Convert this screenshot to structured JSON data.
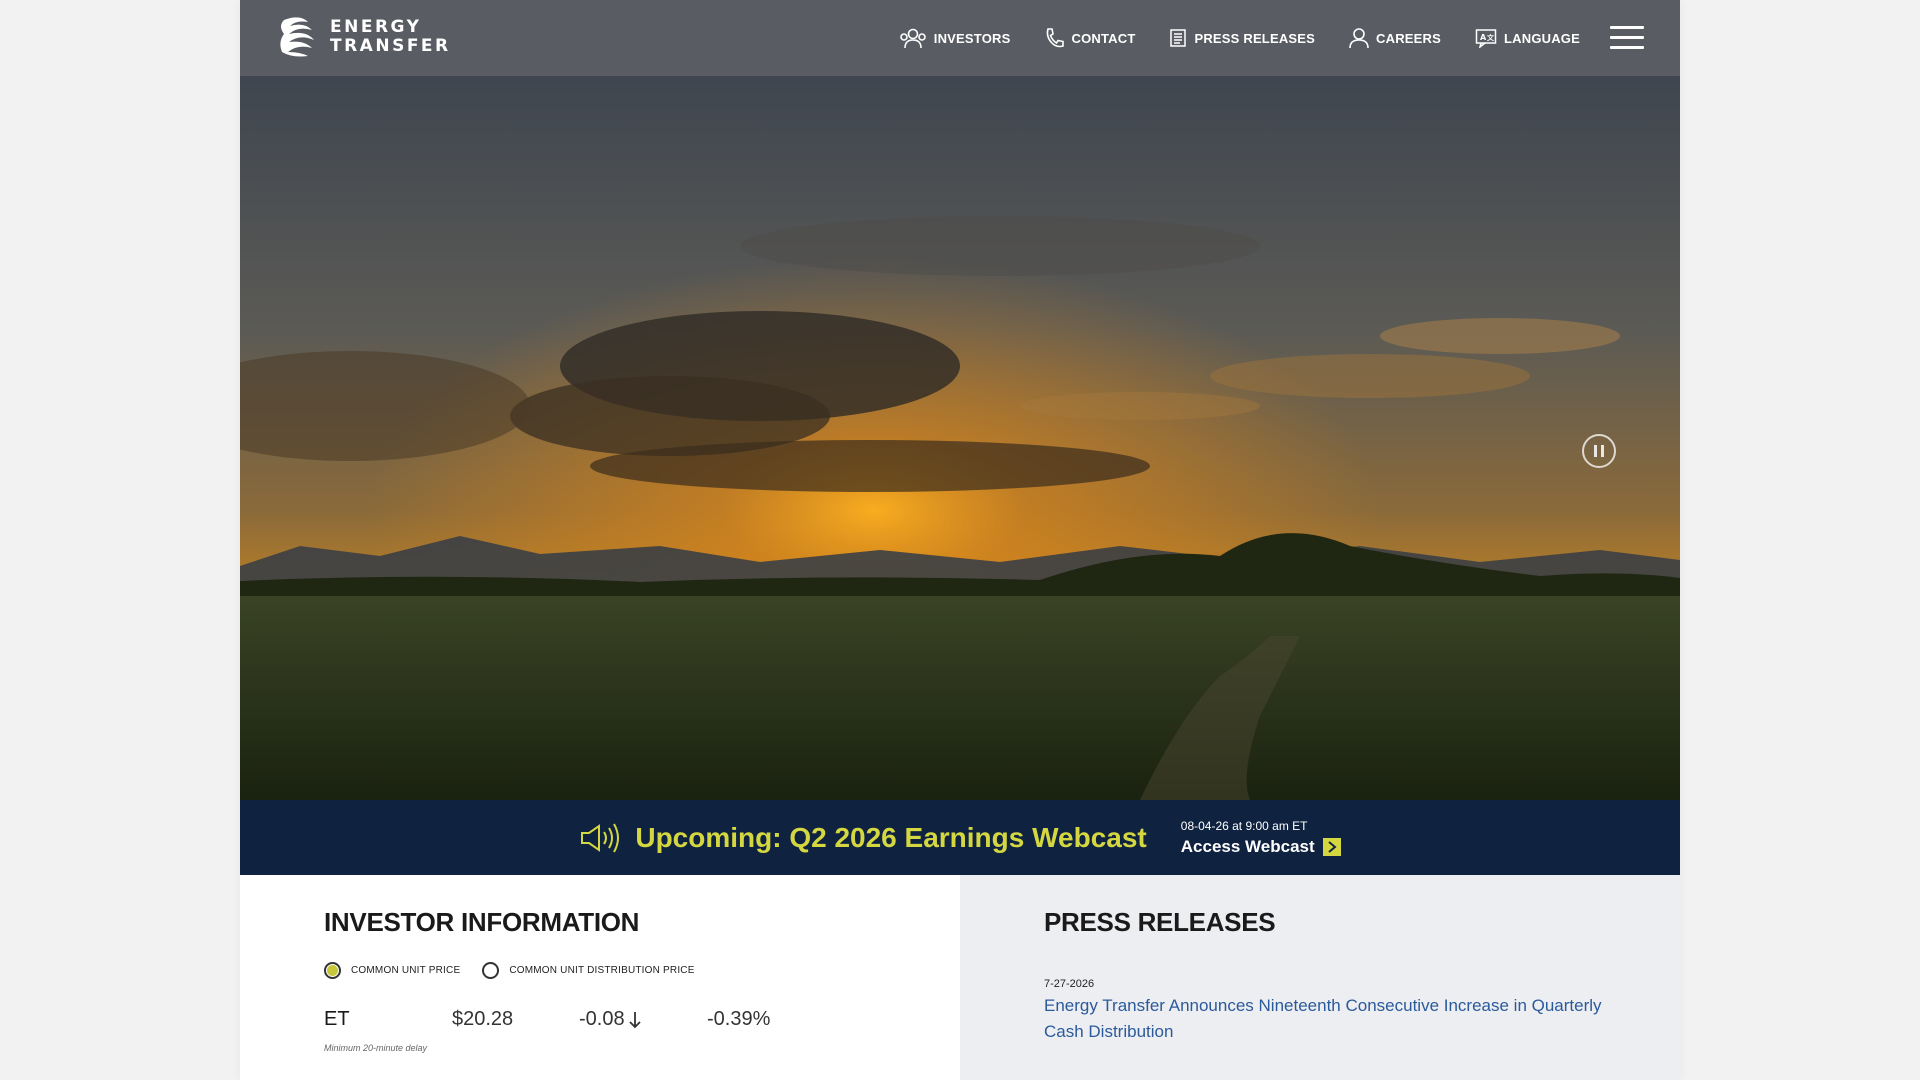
{
  "logo": {
    "line1": "ENERGY",
    "line2": "TRANSFER"
  },
  "nav": {
    "items": [
      {
        "label": "INVESTORS",
        "icon": "investors-icon"
      },
      {
        "label": "CONTACT",
        "icon": "phone-icon"
      },
      {
        "label": "PRESS RELEASES",
        "icon": "document-icon"
      },
      {
        "label": "CAREERS",
        "icon": "person-icon"
      },
      {
        "label": "LANGUAGE",
        "icon": "language-icon"
      }
    ],
    "menu_icon": "hamburger-menu-icon"
  },
  "hero": {
    "pause_icon": "pause-icon"
  },
  "banner": {
    "title": "Upcoming: Q2 2026 Earnings Webcast",
    "date": "08-04-26 at 9:00 am ET",
    "link": "Access Webcast",
    "accent_color": "#d4d73f",
    "background_color": "#0f2340"
  },
  "investor": {
    "title": "INVESTOR INFORMATION",
    "options": [
      {
        "label": "COMMON UNIT PRICE",
        "selected": true
      },
      {
        "label": "COMMON UNIT DISTRIBUTION PRICE",
        "selected": false
      }
    ],
    "ticker": "ET",
    "price": "$20.28",
    "change": "-0.08",
    "change_percent": "-0.39%",
    "delay_note": "Minimum 20-minute delay"
  },
  "press": {
    "title": "PRESS RELEASES",
    "items": [
      {
        "date": "7-27-2026",
        "headline": "Energy Transfer Announces Nineteenth Consecutive Increase in Quarterly Cash Distribution"
      }
    ]
  }
}
